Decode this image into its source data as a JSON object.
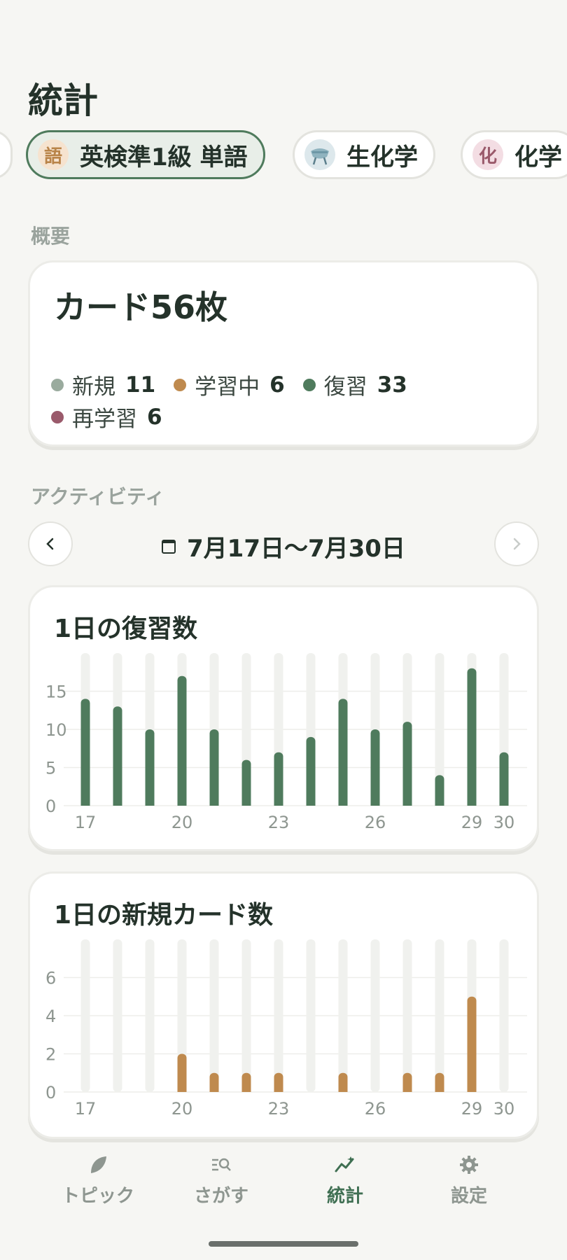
{
  "page": {
    "title": "統計"
  },
  "topics": [
    {
      "badge": "語",
      "label": "英検準1級 単語",
      "badge_bg": "#f6e3cf",
      "badge_color": "#b98449",
      "selected": true
    },
    {
      "badge": "",
      "label": "生化学",
      "badge_bg": "#dde8ec",
      "badge_color": "#4d7a8a",
      "selected": false
    },
    {
      "badge": "化",
      "label": "化学",
      "badge_bg": "#f3dde3",
      "badge_color": "#9a5a6b",
      "selected": false
    }
  ],
  "overview": {
    "section_label": "概要",
    "total": "カード56枚",
    "legend": [
      {
        "name": "新規",
        "value": "11",
        "color": "#9aab9e"
      },
      {
        "name": "学習中",
        "value": "6",
        "color": "#bf8a4e"
      },
      {
        "name": "復習",
        "value": "33",
        "color": "#4f7b5d"
      },
      {
        "name": "再学習",
        "value": "6",
        "color": "#9a5a6b"
      }
    ]
  },
  "activity": {
    "section_label": "アクティビティ",
    "range": "7月17日〜7月30日",
    "prev_icon": "chevron-left-icon",
    "next_icon": "chevron-right-icon"
  },
  "chart_data": [
    {
      "type": "bar",
      "title": "1日の復習数",
      "x": [
        17,
        18,
        19,
        20,
        21,
        22,
        23,
        24,
        25,
        26,
        27,
        28,
        29,
        30
      ],
      "x_tick_labels": [
        "17",
        "20",
        "23",
        "26",
        "29",
        "30"
      ],
      "values": [
        14,
        13,
        10,
        17,
        10,
        6,
        7,
        9,
        14,
        10,
        11,
        4,
        18,
        7
      ],
      "y_ticks": [
        0,
        5,
        10,
        15
      ],
      "ylim": [
        0,
        20
      ],
      "color": "#4f7b5d",
      "grid": true
    },
    {
      "type": "bar",
      "title": "1日の新規カード数",
      "x": [
        17,
        18,
        19,
        20,
        21,
        22,
        23,
        24,
        25,
        26,
        27,
        28,
        29,
        30
      ],
      "x_tick_labels": [
        "17",
        "20",
        "23",
        "26",
        "29",
        "30"
      ],
      "values": [
        0,
        0,
        0,
        2,
        1,
        1,
        1,
        0,
        1,
        0,
        1,
        1,
        5,
        0
      ],
      "y_ticks": [
        0,
        2,
        4,
        6
      ],
      "ylim": [
        0,
        8
      ],
      "color": "#bf8a4e",
      "grid": true
    }
  ],
  "bottom_nav": [
    {
      "label": "トピック",
      "icon": "leaf-icon",
      "active": false
    },
    {
      "label": "さがす",
      "icon": "search-list-icon",
      "active": false
    },
    {
      "label": "統計",
      "icon": "trend-icon",
      "active": true
    },
    {
      "label": "設定",
      "icon": "gear-icon",
      "active": false
    }
  ]
}
